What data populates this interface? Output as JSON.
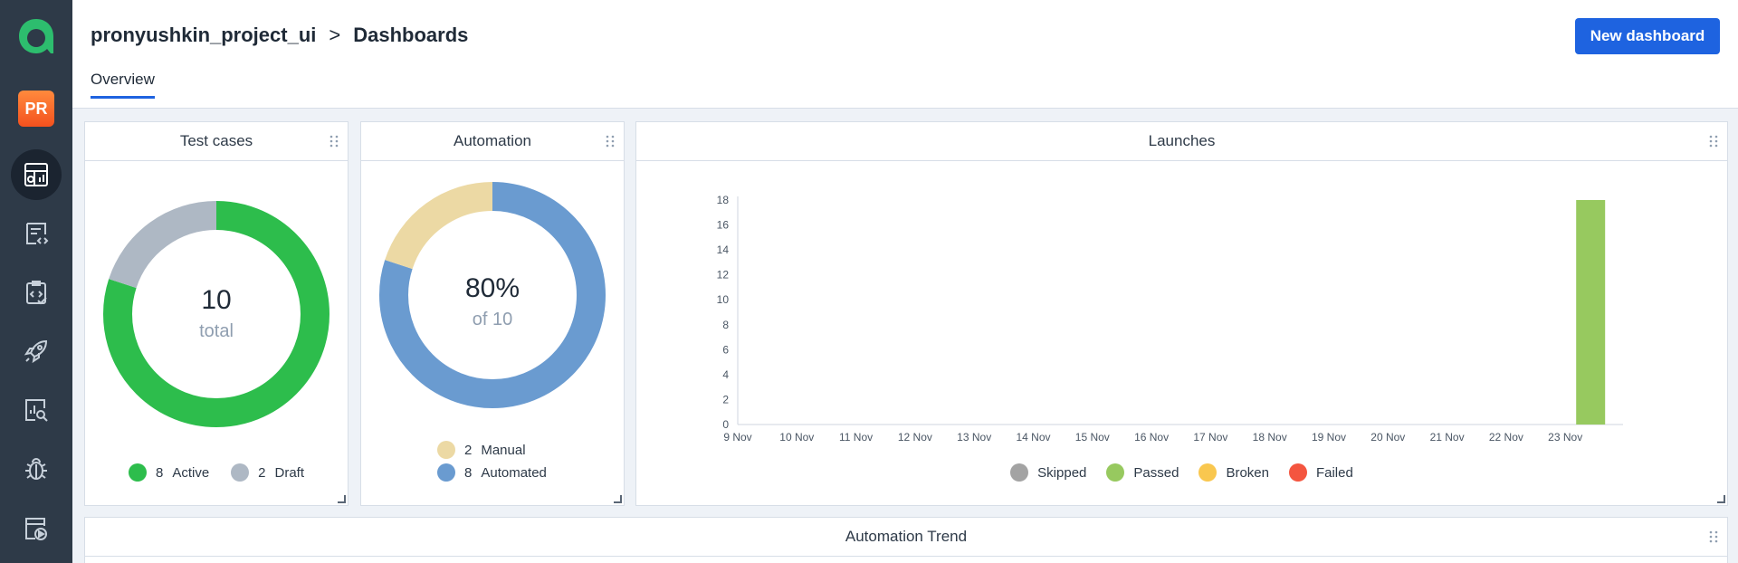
{
  "breadcrumb": {
    "project": "pronyushkin_project_ui",
    "separator": ">",
    "page": "Dashboards"
  },
  "actions": {
    "new_dashboard": "New dashboard"
  },
  "tabs": [
    {
      "label": "Overview"
    }
  ],
  "sidebar": {
    "avatar": "PR",
    "items": [
      {
        "icon": "dashboard-icon"
      },
      {
        "icon": "test-cases-icon"
      },
      {
        "icon": "test-plans-icon"
      },
      {
        "icon": "launches-icon"
      },
      {
        "icon": "analytics-icon"
      },
      {
        "icon": "defects-icon"
      },
      {
        "icon": "jobs-icon"
      }
    ]
  },
  "widgets": {
    "test_cases": {
      "title": "Test cases",
      "total": "10",
      "total_label": "total",
      "legend": [
        {
          "count": "8",
          "label": "Active",
          "color": "#2dbd4c"
        },
        {
          "count": "2",
          "label": "Draft",
          "color": "#aeb8c4"
        }
      ]
    },
    "automation": {
      "title": "Automation",
      "percent": "80%",
      "of_label": "of 10",
      "legend": [
        {
          "count": "2",
          "label": "Manual",
          "color": "#ecd9a4"
        },
        {
          "count": "8",
          "label": "Automated",
          "color": "#6a9bd0"
        }
      ]
    },
    "launches": {
      "title": "Launches",
      "legend": [
        {
          "label": "Skipped",
          "color": "#a3a3a3"
        },
        {
          "label": "Passed",
          "color": "#97c95f"
        },
        {
          "label": "Broken",
          "color": "#f9c74f"
        },
        {
          "label": "Failed",
          "color": "#f4553f"
        }
      ]
    },
    "automation_trend": {
      "title": "Automation Trend"
    }
  },
  "chart_data": [
    {
      "type": "pie",
      "title": "Test cases",
      "slices": [
        {
          "label": "Active",
          "value": 8
        },
        {
          "label": "Draft",
          "value": 2
        }
      ]
    },
    {
      "type": "pie",
      "title": "Automation",
      "slices": [
        {
          "label": "Manual",
          "value": 2
        },
        {
          "label": "Automated",
          "value": 8
        }
      ]
    },
    {
      "type": "bar",
      "title": "Launches",
      "categories": [
        "9 Nov",
        "10 Nov",
        "11 Nov",
        "12 Nov",
        "13 Nov",
        "14 Nov",
        "15 Nov",
        "16 Nov",
        "17 Nov",
        "18 Nov",
        "19 Nov",
        "20 Nov",
        "21 Nov",
        "22 Nov",
        "23 Nov"
      ],
      "series": [
        {
          "name": "Skipped",
          "values": [
            0,
            0,
            0,
            0,
            0,
            0,
            0,
            0,
            0,
            0,
            0,
            0,
            0,
            0,
            0
          ]
        },
        {
          "name": "Passed",
          "values": [
            0,
            0,
            0,
            0,
            0,
            0,
            0,
            0,
            0,
            0,
            0,
            0,
            0,
            0,
            18
          ]
        },
        {
          "name": "Broken",
          "values": [
            0,
            0,
            0,
            0,
            0,
            0,
            0,
            0,
            0,
            0,
            0,
            0,
            0,
            0,
            0
          ]
        },
        {
          "name": "Failed",
          "values": [
            0,
            0,
            0,
            0,
            0,
            0,
            0,
            0,
            0,
            0,
            0,
            0,
            0,
            0,
            0
          ]
        }
      ],
      "yticks": [
        0,
        2,
        4,
        6,
        8,
        10,
        12,
        14,
        16,
        18
      ],
      "ylim": [
        0,
        18
      ],
      "grid": false,
      "legend": "bottom"
    }
  ]
}
